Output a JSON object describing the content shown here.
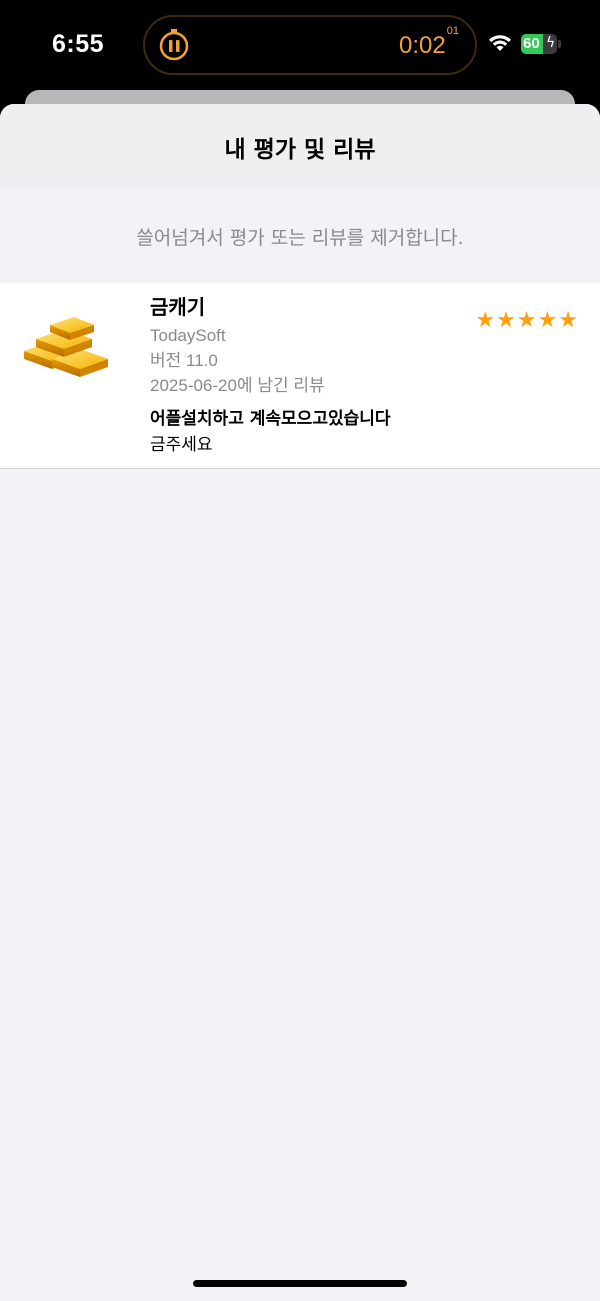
{
  "status_bar": {
    "time": "6:55",
    "timer_main": "0:02",
    "timer_fraction": "01",
    "battery_level": "60",
    "battery_percent": 60,
    "icons": [
      "pause-icon",
      "wifi-icon",
      "battery-icon",
      "bolt-icon"
    ]
  },
  "sheet": {
    "title": "내 평가 및 리뷰",
    "hint": "쓸어넘겨서 평가 또는 리뷰를 제거합니다."
  },
  "reviews": [
    {
      "app_name": "금캐기",
      "developer": "TodaySoft",
      "version": "버전 11.0",
      "date_text": "2025-06-20에 남긴 리뷰",
      "rating": 5,
      "rating_display": "★★★★★",
      "review_title": "어플설치하고 계속모으고있습니다",
      "review_body": "금주세요",
      "icon": "gold-bars-icon"
    }
  ],
  "colors": {
    "accent_orange": "#ff9f0a",
    "timer_orange": "#f2a13a",
    "battery_green": "#34c759",
    "secondary_text": "#8a8a8e",
    "sheet_background": "#f2f2f7"
  }
}
